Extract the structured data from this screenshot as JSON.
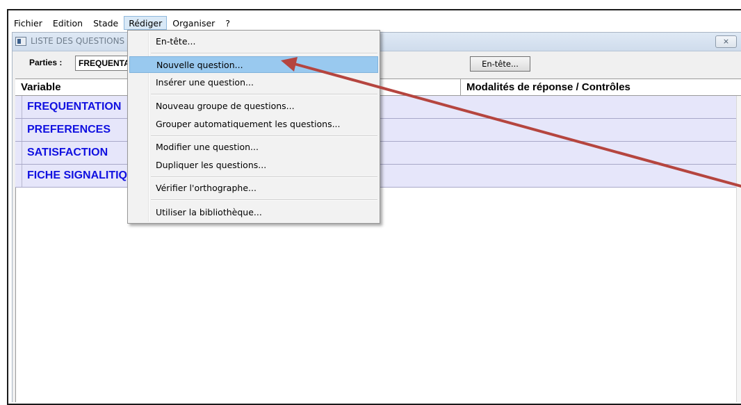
{
  "menubar": {
    "items": [
      "Fichier",
      "Edition",
      "Stade",
      "Rédiger",
      "Organiser",
      "?"
    ],
    "active": "Rédiger"
  },
  "window": {
    "title": "LISTE DES QUESTIONS",
    "close_label": "⨯"
  },
  "toolbar": {
    "parties_label": "Parties :",
    "parties_value": "FREQUENTATION",
    "entete_button": "En-tête..."
  },
  "table": {
    "columns": [
      "Variable",
      "Modalités de réponse / Contrôles"
    ],
    "rows": [
      "FREQUENTATION",
      "PREFERENCES",
      "SATISFACTION",
      "FICHE SIGNALITIQUE"
    ]
  },
  "dropdown": {
    "items": [
      "En-tête...",
      "Nouvelle question...",
      "Insérer une question...",
      "Nouveau groupe de questions...",
      "Grouper automatiquement les questions...",
      "Modifier une question...",
      "Dupliquer les questions...",
      "Vérifier l'orthographe...",
      "Utiliser la bibliothèque..."
    ],
    "highlighted": "Nouvelle question..."
  },
  "colors": {
    "row_text": "#1010e0",
    "row_background": "#e6e6fa",
    "highlight": "#99c9ef",
    "arrow": "#b5453f"
  },
  "icons": {
    "window_icon": "window-icon",
    "close_icon": "close-icon"
  }
}
